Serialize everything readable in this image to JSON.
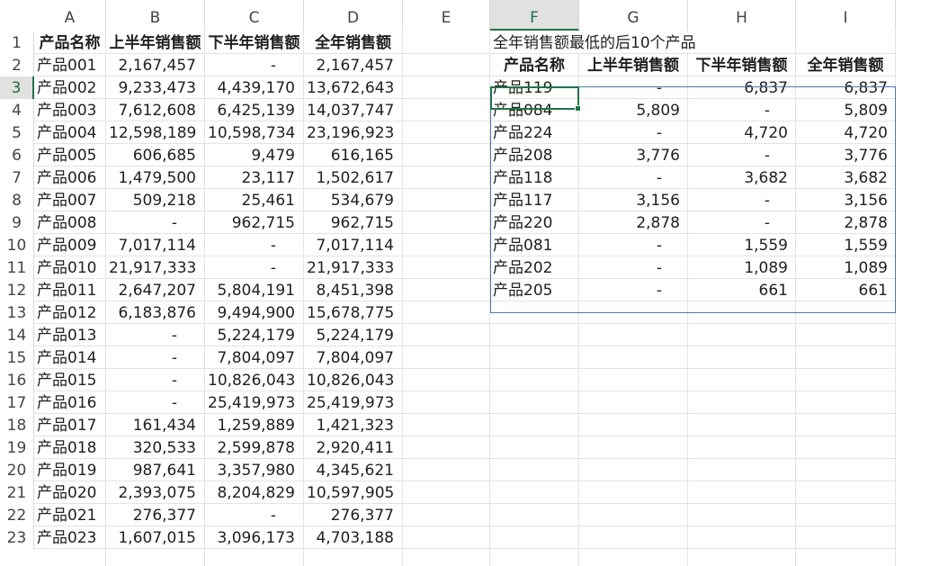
{
  "sheet": {
    "columns": [
      "A",
      "B",
      "C",
      "D",
      "E",
      "F",
      "G",
      "H",
      "I"
    ],
    "active_column": "F",
    "active_row": "3",
    "rows": [
      "1",
      "2",
      "3",
      "4",
      "5",
      "6",
      "7",
      "8",
      "9",
      "10",
      "11",
      "12",
      "13",
      "14",
      "15",
      "16",
      "17",
      "18",
      "19",
      "20",
      "21",
      "22",
      "23"
    ]
  },
  "main_table": {
    "headers": [
      "产品名称",
      "上半年销售额",
      "下半年销售额",
      "全年销售额"
    ],
    "rows": [
      [
        "产品001",
        "2,167,457",
        "-",
        "2,167,457"
      ],
      [
        "产品002",
        "9,233,473",
        "4,439,170",
        "13,672,643"
      ],
      [
        "产品003",
        "7,612,608",
        "6,425,139",
        "14,037,747"
      ],
      [
        "产品004",
        "12,598,189",
        "10,598,734",
        "23,196,923"
      ],
      [
        "产品005",
        "606,685",
        "9,479",
        "616,165"
      ],
      [
        "产品006",
        "1,479,500",
        "23,117",
        "1,502,617"
      ],
      [
        "产品007",
        "509,218",
        "25,461",
        "534,679"
      ],
      [
        "产品008",
        "-",
        "962,715",
        "962,715"
      ],
      [
        "产品009",
        "7,017,114",
        "-",
        "7,017,114"
      ],
      [
        "产品010",
        "21,917,333",
        "-",
        "21,917,333"
      ],
      [
        "产品011",
        "2,647,207",
        "5,804,191",
        "8,451,398"
      ],
      [
        "产品012",
        "6,183,876",
        "9,494,900",
        "15,678,775"
      ],
      [
        "产品013",
        "-",
        "5,224,179",
        "5,224,179"
      ],
      [
        "产品014",
        "-",
        "7,804,097",
        "7,804,097"
      ],
      [
        "产品015",
        "-",
        "10,826,043",
        "10,826,043"
      ],
      [
        "产品016",
        "-",
        "25,419,973",
        "25,419,973"
      ],
      [
        "产品017",
        "161,434",
        "1,259,889",
        "1,421,323"
      ],
      [
        "产品018",
        "320,533",
        "2,599,878",
        "2,920,411"
      ],
      [
        "产品019",
        "987,641",
        "3,357,980",
        "4,345,621"
      ],
      [
        "产品020",
        "2,393,075",
        "8,204,829",
        "10,597,905"
      ],
      [
        "产品021",
        "276,377",
        "-",
        "276,377"
      ],
      [
        "产品023",
        "1,607,015",
        "3,096,173",
        "4,703,188"
      ]
    ]
  },
  "summary": {
    "title": "全年销售额最低的后10个产品",
    "headers": [
      "产品名称",
      "上半年销售额",
      "下半年销售额",
      "全年销售额"
    ],
    "rows": [
      [
        "产品119",
        "-",
        "6,837",
        "6,837"
      ],
      [
        "产品084",
        "5,809",
        "-",
        "5,809"
      ],
      [
        "产品224",
        "-",
        "4,720",
        "4,720"
      ],
      [
        "产品208",
        "3,776",
        "-",
        "3,776"
      ],
      [
        "产品118",
        "-",
        "3,682",
        "3,682"
      ],
      [
        "产品117",
        "3,156",
        "-",
        "3,156"
      ],
      [
        "产品220",
        "2,878",
        "-",
        "2,878"
      ],
      [
        "产品081",
        "-",
        "1,559",
        "1,559"
      ],
      [
        "产品202",
        "-",
        "1,089",
        "1,089"
      ],
      [
        "产品205",
        "-",
        "661",
        "661"
      ]
    ]
  }
}
